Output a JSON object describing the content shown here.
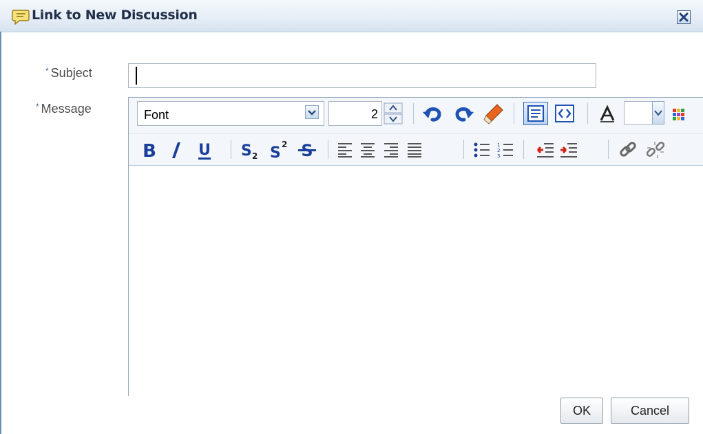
{
  "dialog": {
    "title": "Link to New Discussion",
    "icon": "discussion-icon",
    "close_icon": "close-icon"
  },
  "form": {
    "required_marker": "*",
    "subject_label": "Subject",
    "subject_value": "",
    "message_label": "Message"
  },
  "toolbar": {
    "font_value": "Font",
    "size_value": "2",
    "row1_icons": [
      "undo-icon",
      "redo-icon",
      "clear-formatting-icon",
      "rich-text-mode-icon",
      "source-mode-icon",
      "font-color-icon",
      "color-dropdown-icon",
      "background-color-icon"
    ],
    "row2_icons": [
      "bold-icon",
      "italic-icon",
      "underline-icon",
      "subscript-icon",
      "superscript-icon",
      "strikethrough-icon",
      "align-left-icon",
      "align-center-icon",
      "align-right-icon",
      "justify-icon",
      "bulleted-list-icon",
      "numbered-list-icon",
      "outdent-icon",
      "indent-icon",
      "link-icon",
      "unlink-icon"
    ]
  },
  "buttons": {
    "ok": "OK",
    "cancel": "Cancel"
  },
  "colors": {
    "title_bar": "#e6eef7",
    "label_text": "#4a4a4a",
    "required_marker": "#3d5f8c",
    "icon_blue": "#1a3f9a"
  }
}
